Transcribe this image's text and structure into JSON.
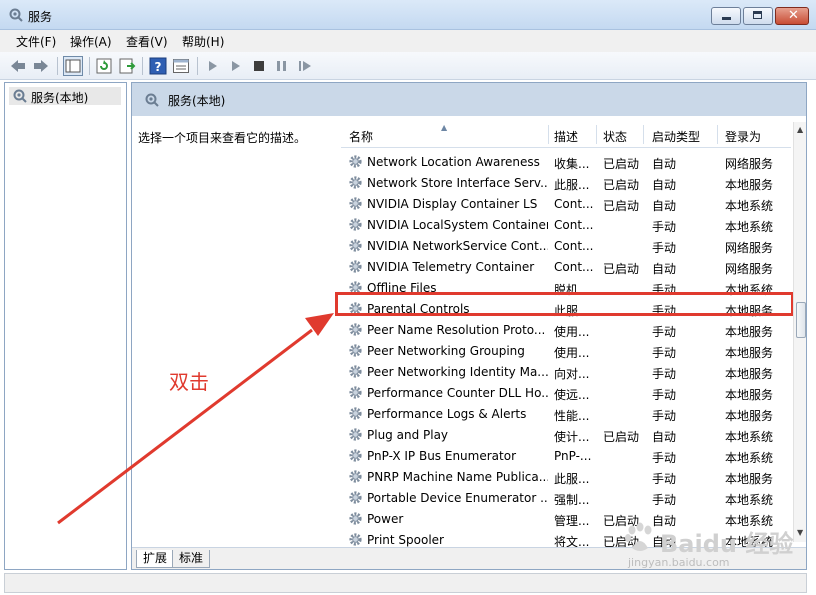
{
  "window": {
    "title": "服务"
  },
  "menu": [
    "文件(F)",
    "操作(A)",
    "查看(V)",
    "帮助(H)"
  ],
  "tree": {
    "root": "服务(本地)"
  },
  "main": {
    "header_title": "服务(本地)",
    "description_prompt": "选择一个项目来查看它的描述。",
    "columns": [
      "名称",
      "描述",
      "状态",
      "启动类型",
      "登录为"
    ],
    "rows": [
      [
        "Network Location Awareness",
        "收集...",
        "已启动",
        "自动",
        "网络服务"
      ],
      [
        "Network Store Interface Serv...",
        "此服...",
        "已启动",
        "自动",
        "本地服务"
      ],
      [
        "NVIDIA Display Container LS",
        "Cont...",
        "已启动",
        "自动",
        "本地系统"
      ],
      [
        "NVIDIA LocalSystem Container",
        "Cont...",
        "",
        "手动",
        "本地系统"
      ],
      [
        "NVIDIA NetworkService Cont...",
        "Cont...",
        "",
        "手动",
        "网络服务"
      ],
      [
        "NVIDIA Telemetry Container",
        "Cont...",
        "已启动",
        "自动",
        "网络服务"
      ],
      [
        "Offline Files",
        "脱机...",
        "",
        "手动",
        "本地系统"
      ],
      [
        "Parental Controls",
        "此服...",
        "",
        "手动",
        "本地服务"
      ],
      [
        "Peer Name Resolution Proto...",
        "使用...",
        "",
        "手动",
        "本地服务"
      ],
      [
        "Peer Networking Grouping",
        "使用...",
        "",
        "手动",
        "本地服务"
      ],
      [
        "Peer Networking Identity Ma...",
        "向对...",
        "",
        "手动",
        "本地服务"
      ],
      [
        "Performance Counter DLL Ho...",
        "使远...",
        "",
        "手动",
        "本地服务"
      ],
      [
        "Performance Logs & Alerts",
        "性能...",
        "",
        "手动",
        "本地服务"
      ],
      [
        "Plug and Play",
        "使计...",
        "已启动",
        "自动",
        "本地系统"
      ],
      [
        "PnP-X IP Bus Enumerator",
        "PnP-...",
        "",
        "手动",
        "本地系统"
      ],
      [
        "PNRP Machine Name Publica...",
        "此服...",
        "",
        "手动",
        "本地服务"
      ],
      [
        "Portable Device Enumerator ...",
        "强制...",
        "",
        "手动",
        "本地系统"
      ],
      [
        "Power",
        "管理...",
        "已启动",
        "自动",
        "本地系统"
      ],
      [
        "Print Spooler",
        "将文...",
        "已启动",
        "自动",
        "本地系统"
      ]
    ]
  },
  "tabs": [
    "扩展",
    "标准"
  ],
  "annotation": {
    "text": "双击",
    "color": "#e03a2e"
  },
  "watermark": {
    "main": "Baidu 经验",
    "sub": "jingyan.baidu.com"
  },
  "colors": {
    "accent_red": "#e03a2e",
    "header_band": "#cad8e8",
    "title_bar": "#c4d9f1"
  },
  "icons": {
    "service": "gear-icon",
    "app": "services-icon"
  }
}
